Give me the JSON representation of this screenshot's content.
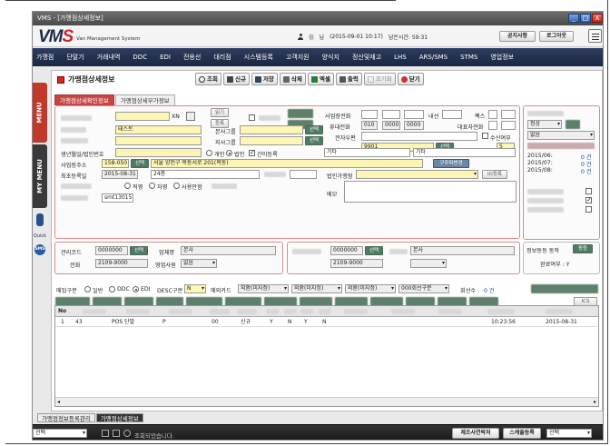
{
  "window": {
    "title": "VMS - [가맹점상세정보]",
    "min": "_",
    "max": "□",
    "close": "X"
  },
  "header": {
    "logo": "VMS",
    "logo_sub": "Van Management System",
    "user_name": "김",
    "user_role": "님",
    "datetime": "(2015-09-01 10:17)",
    "remaining": "남은시간: 59:31",
    "notice_btn": "공지사항",
    "logout_btn": "로그아웃"
  },
  "menu": [
    "가맹점",
    "단말기",
    "거래내역",
    "DDC",
    "EDI",
    "전용선",
    "대리점",
    "시스템등록",
    "고객지원",
    "양식지",
    "정산및재고",
    "LHS",
    "ARS/SMS",
    "STMS",
    "영업정보"
  ],
  "side": {
    "menu": "MENU",
    "my_menu": "MY MENU",
    "quick": "Quick",
    "sms": "SMS"
  },
  "page_title": "가맹점상세정보",
  "toolbar": [
    "조회",
    "신규",
    "저장",
    "삭제",
    "엑셀",
    "출력",
    "초기화",
    "닫기"
  ],
  "tabs": [
    "가맹점상세확인정보",
    "가맹점상세부가정보"
  ],
  "form": {
    "lookup_btn": "읽기",
    "register_btn": "등록",
    "xn": "XN",
    "name_value": "테스트",
    "biz_phone_label": "사업장전화",
    "ext_label": "내선",
    "fax_label": "팩스",
    "mobile_label": "휴대전화",
    "mobile_1": "010",
    "mobile_2": "0000",
    "mobile_3": "0000",
    "rep_phone_label": "대표자전화",
    "email_label": "전자우편",
    "receive_label": "수신여부",
    "hq_group_label": "본사그룹",
    "branch_group_label": "지사그룹",
    "code_9901": "9901",
    "count_5": "5",
    "select_btn": "선택",
    "birth_label": "생년월일/법인번호",
    "personal_label": "개인",
    "corp_label": "법인",
    "simple_label": "간이등록",
    "etc1": "기타",
    "etc2": "기타",
    "biz_addr_label": "사업장주소",
    "zip": "158-050",
    "address": "서울 양천구 목동서로 201(목동)",
    "first_reg_label": "최초등록일",
    "first_reg": "2015-08-31",
    "floor": "24층",
    "corp_chain_label": "법인가맹점",
    "id_reg": "ID등록",
    "bank_change": "구주파변경",
    "direct_label": "직영",
    "self_label": "자영",
    "sole_label": "사용안함",
    "memo_label": "메모",
    "agent_code": "smt13015"
  },
  "right_panel": {
    "status": "정상",
    "status2": "없음",
    "months": [
      {
        "label": "2015/06:",
        "value": "0 건"
      },
      {
        "label": "2015/07:",
        "value": "0 건"
      },
      {
        "label": "2015/08:",
        "value": "0 건"
      }
    ],
    "sync_label": "정보동등 동작",
    "sync_btn": "동등",
    "done_label": "완료여부 : Y"
  },
  "mgmt": {
    "code_label": "관리코드",
    "code": "0000000",
    "phone_label": "전화",
    "phone": "2109-9000",
    "type_label": "업체명",
    "type": "본사",
    "biz_label": "영업사원",
    "biz": "없음",
    "code2": "0000000",
    "type2": "본사",
    "phone2": "2109-9000"
  },
  "filter": {
    "buy_label": "매입구분",
    "general": "일반",
    "ddc": "DDC",
    "edi": "EDI",
    "desc_label": "DESC구분",
    "desc": "N",
    "card_label": "매외카드",
    "opt1": "외환(미지정)",
    "opt2": "외환(미지정)",
    "opt3": "외환(미지정)",
    "opt4": "000회선구분",
    "lines_label": "회선수 :",
    "lines": "0 건",
    "ics": "ICS"
  },
  "grid": {
    "headers": [
      "No",
      "",
      "",
      "",
      "",
      ""
    ],
    "rows": [
      {
        "no": "1",
        "col1": "43",
        "col2": "POS 단말",
        "col3": "P",
        "col4": "00",
        "col5": "신규",
        "c6": "Y",
        "c7": "N",
        "c8": "Y",
        "c9": "N",
        "time": "10:23:56",
        "date": "2015-08-31"
      }
    ]
  },
  "bottom_tabs": [
    "가맹점정보등록관리",
    "가맹점상세정보"
  ],
  "statusbar": {
    "select": "선택",
    "msg": "조회되었습니다.",
    "btn1": "제조사연락처",
    "btn2": "스케줄등록",
    "select2": "선택"
  },
  "crop_text": "ⓒ ... ..."
}
